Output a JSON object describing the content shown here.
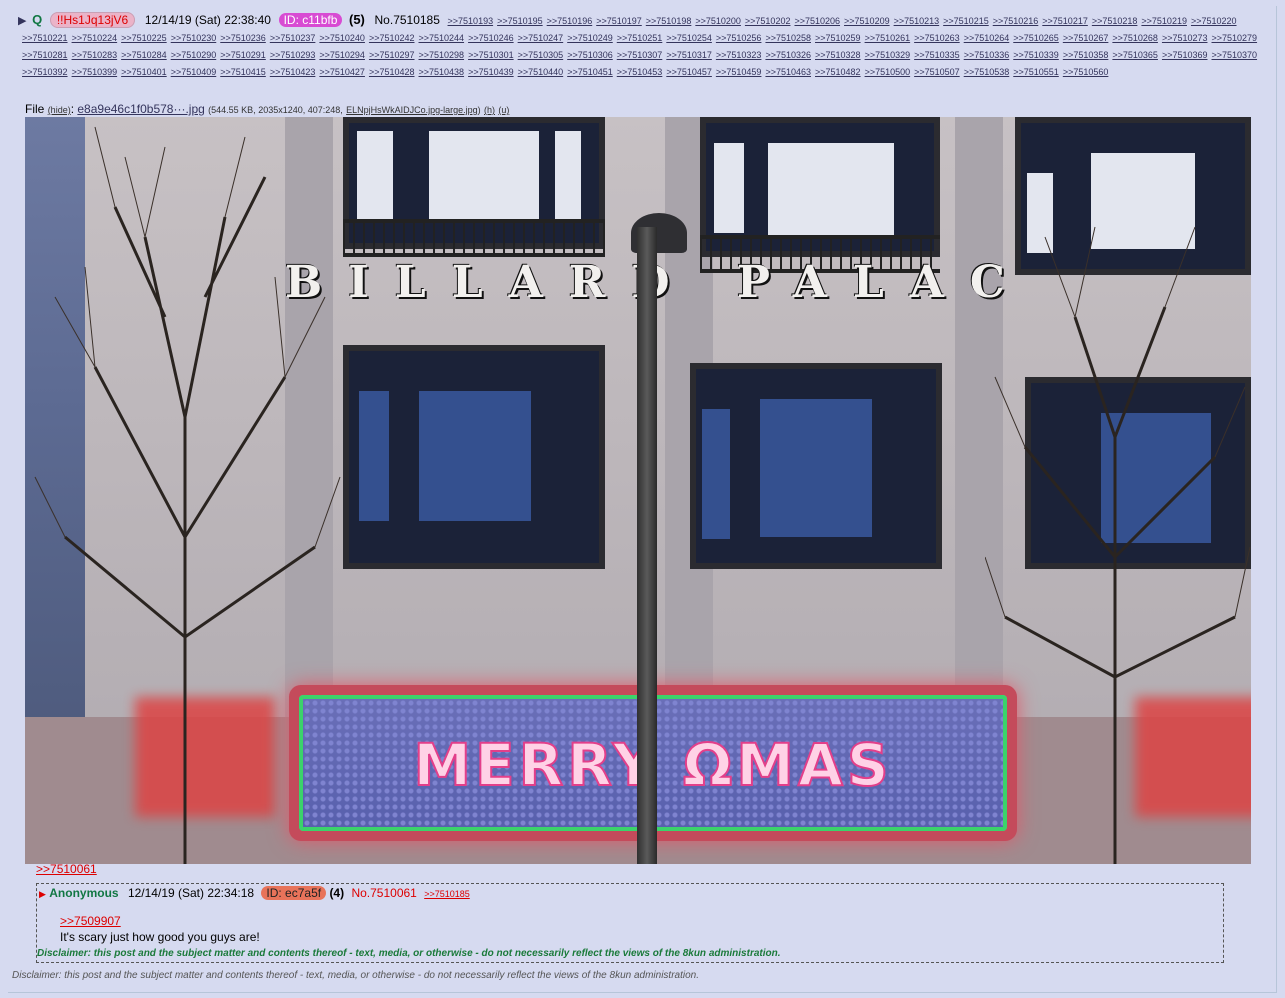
{
  "post": {
    "name": "Q",
    "tripcode": "!!Hs1Jq13jV6",
    "date": "12/14/19 (Sat) 22:38:40",
    "id": "ID: c11bfb",
    "count": "(5)",
    "number": "No.7510185",
    "mentions": [
      ">>7510193",
      ">>7510195",
      ">>7510196",
      ">>7510197",
      ">>7510198",
      ">>7510200",
      ">>7510202",
      ">>7510206",
      ">>7510209",
      ">>7510213",
      ">>7510215",
      ">>7510216",
      ">>7510217",
      ">>7510218",
      ">>7510219",
      ">>7510220",
      ">>7510221",
      ">>7510224",
      ">>7510225",
      ">>7510230",
      ">>7510236",
      ">>7510237",
      ">>7510240",
      ">>7510242",
      ">>7510244",
      ">>7510246",
      ">>7510247",
      ">>7510249",
      ">>7510251",
      ">>7510254",
      ">>7510256",
      ">>7510258",
      ">>7510259",
      ">>7510261",
      ">>7510263",
      ">>7510264",
      ">>7510265",
      ">>7510267",
      ">>7510268",
      ">>7510273",
      ">>7510279",
      ">>7510281",
      ">>7510283",
      ">>7510284",
      ">>7510290",
      ">>7510291",
      ">>7510293",
      ">>7510294",
      ">>7510297",
      ">>7510298",
      ">>7510301",
      ">>7510305",
      ">>7510306",
      ">>7510307",
      ">>7510317",
      ">>7510323",
      ">>7510326",
      ">>7510328",
      ">>7510329",
      ">>7510335",
      ">>7510336",
      ">>7510339",
      ">>7510358",
      ">>7510365",
      ">>7510369",
      ">>7510370",
      ">>7510392",
      ">>7510399",
      ">>7510401",
      ">>7510409",
      ">>7510415",
      ">>7510423",
      ">>7510427",
      ">>7510428",
      ">>7510438",
      ">>7510439",
      ">>7510440",
      ">>7510451",
      ">>7510453",
      ">>7510457",
      ">>7510459",
      ">>7510463",
      ">>7510482",
      ">>7510500",
      ">>7510507",
      ">>7510538",
      ">>7510551",
      ">>7510560"
    ]
  },
  "file": {
    "label": "File",
    "hide": "(hide)",
    "filename": "e8a9e46c1f0b578···.jpg",
    "meta": "(544.55 KB, 2035x1240, 407:248,",
    "origname": "ELNpjHsWkAIDJCo.jpg-large.jpg",
    "meta_close": ")",
    "h": "(h)",
    "u": "(u)"
  },
  "image": {
    "building_text": "BILLARD  PALAC",
    "sign_text": "MERRY ΩMAS"
  },
  "reply": {
    "backlink": ">>7510061",
    "name": "Anonymous",
    "date": "12/14/19 (Sat) 22:34:18",
    "id": "ID: ec7a5f",
    "count": "(4)",
    "number": "No.7510061",
    "backref": ">>7510185",
    "quote": ">>7509907",
    "body": "It's scary just how good you guys are!",
    "disclaimer": "Disclaimer: this post and the subject matter and contents thereof - text, media, or otherwise - do not necessarily reflect the views of the 8kun administration."
  },
  "footer": {
    "disclaimer": "Disclaimer: this post and the subject matter and contents thereof - text, media, or otherwise - do not necessarily reflect the views of the 8kun administration."
  },
  "colors": {
    "background": "#d6daf0",
    "name_green": "#117743",
    "link_blue": "#34345c",
    "quote_red": "#dd0000",
    "id_pill": "#d84bd3"
  }
}
